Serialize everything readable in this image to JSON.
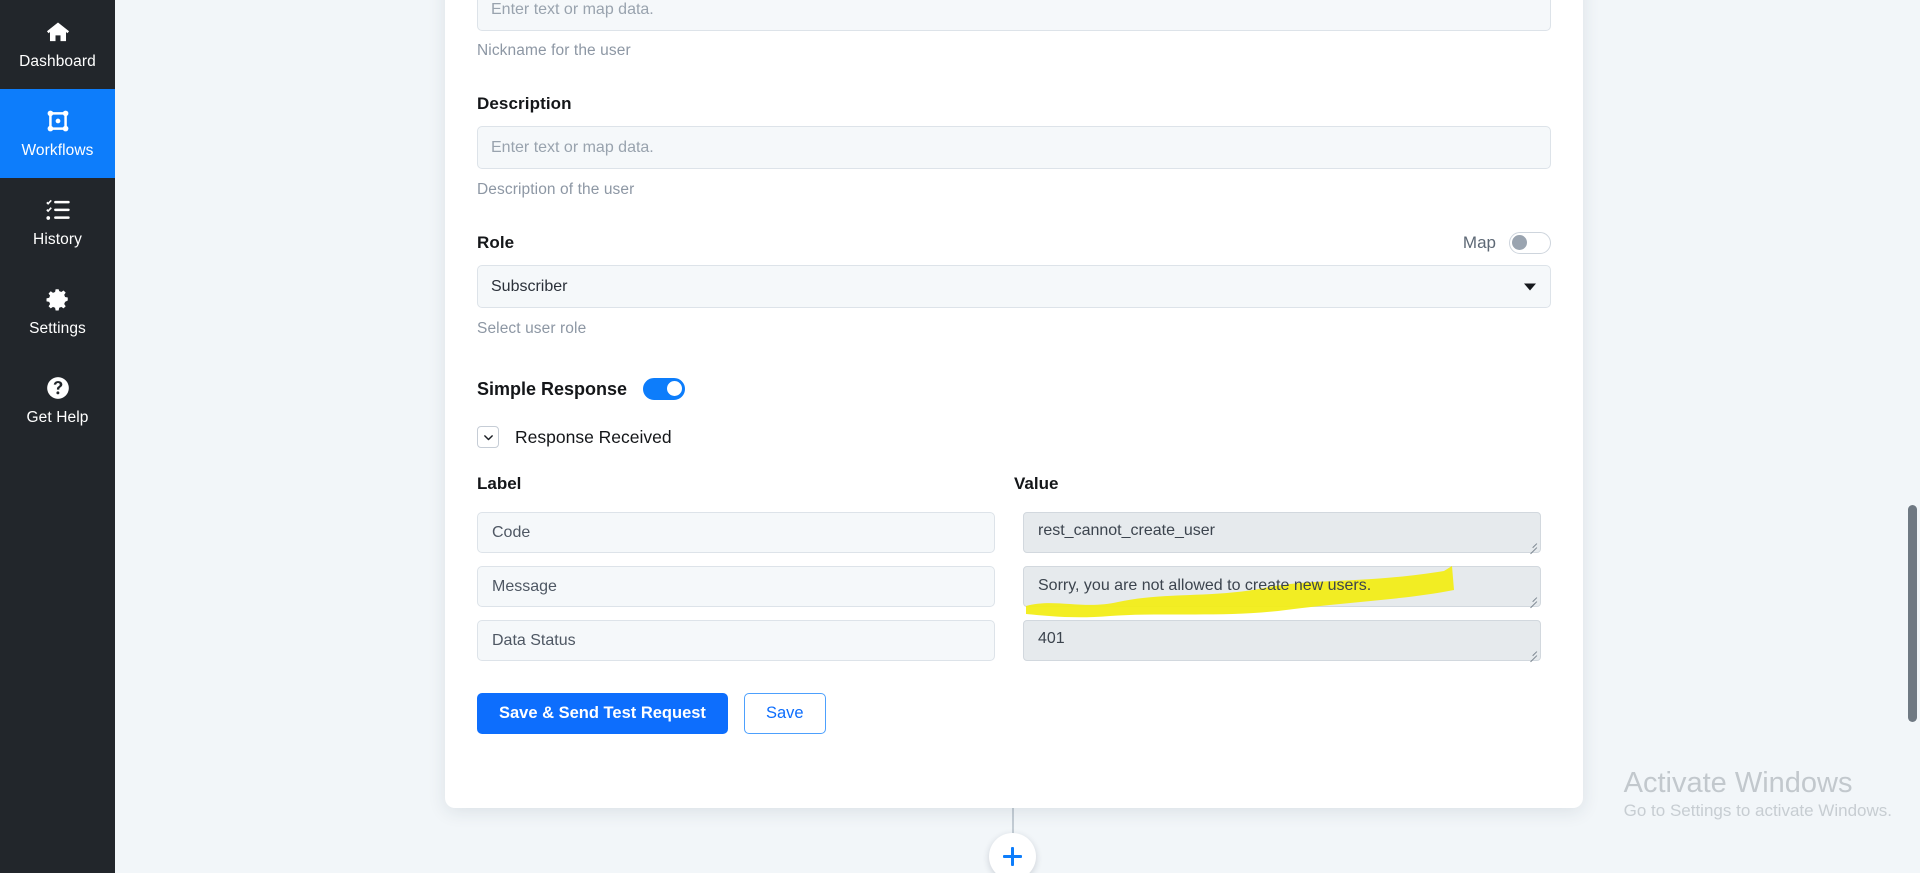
{
  "sidebar": {
    "items": [
      {
        "label": "Dashboard",
        "icon": "home-icon",
        "active": false
      },
      {
        "label": "Workflows",
        "icon": "workflow-icon",
        "active": true
      },
      {
        "label": "History",
        "icon": "history-list-icon",
        "active": false
      },
      {
        "label": "Settings",
        "icon": "gear-icon",
        "active": false
      },
      {
        "label": "Get Help",
        "icon": "question-circle-icon",
        "active": false
      }
    ]
  },
  "form": {
    "nickname": {
      "placeholder": "Enter text or map data.",
      "value": "",
      "help": "Nickname for the user"
    },
    "description": {
      "label": "Description",
      "placeholder": "Enter text or map data.",
      "value": "",
      "help": "Description of the user"
    },
    "role": {
      "label": "Role",
      "map_label": "Map",
      "map_enabled": false,
      "selected": "Subscriber",
      "help": "Select user role"
    },
    "simple_response": {
      "label": "Simple Response",
      "enabled": true
    },
    "response_received": {
      "title": "Response Received",
      "expanded": true,
      "columns": {
        "label": "Label",
        "value": "Value"
      },
      "rows": [
        {
          "label": "Code",
          "value": "rest_cannot_create_user",
          "highlighted": false
        },
        {
          "label": "Message",
          "value": "Sorry, you are not allowed to create new users.",
          "highlighted": true
        },
        {
          "label": "Data Status",
          "value": "401",
          "highlighted": false
        }
      ]
    },
    "buttons": {
      "primary": "Save & Send Test Request",
      "secondary": "Save"
    }
  },
  "canvas": {
    "add_node_label": "+"
  },
  "watermark": {
    "title": "Activate Windows",
    "subtitle": "Go to Settings to activate Windows."
  },
  "colors": {
    "accent": "#0d6efd",
    "sidebar_bg": "#22262b",
    "sidebar_active": "#0d7dfb",
    "highlight": "#f2ed13",
    "canvas_bg": "#f2f6f9"
  }
}
